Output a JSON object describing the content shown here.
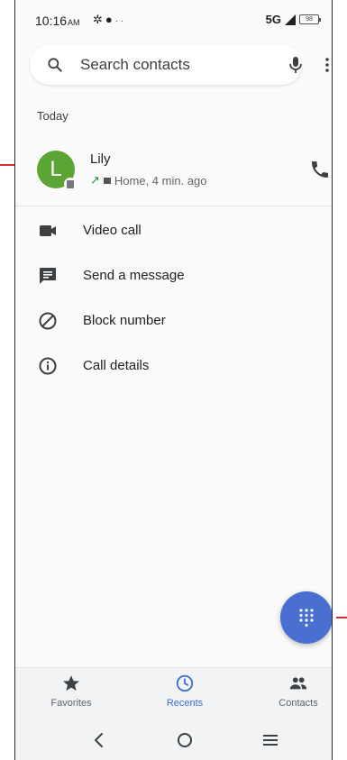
{
  "status_bar": {
    "time": "10:16",
    "ampm": "AM",
    "network": "5G",
    "battery": "98"
  },
  "search": {
    "placeholder": "Search contacts"
  },
  "recents": {
    "section_header": "Today",
    "entries": [
      {
        "name": "Lily",
        "avatar_letter": "L",
        "avatar_color": "#5ba534",
        "call_detail": "Home, 4 min. ago",
        "call_direction": "outgoing"
      }
    ]
  },
  "actions": [
    {
      "label": "Video call",
      "icon": "video-camera-icon"
    },
    {
      "label": "Send a message",
      "icon": "message-icon"
    },
    {
      "label": "Block number",
      "icon": "block-icon"
    },
    {
      "label": "Call details",
      "icon": "info-icon"
    }
  ],
  "bottom_nav": {
    "items": [
      {
        "label": "Favorites",
        "icon": "star-icon",
        "active": false
      },
      {
        "label": "Recents",
        "icon": "clock-icon",
        "active": true
      },
      {
        "label": "Contacts",
        "icon": "people-icon",
        "active": false
      }
    ]
  },
  "colors": {
    "accent": "#3f6bd4",
    "fab": "#4a6fd1",
    "avatar": "#5ba534",
    "callout": "#d32f2f"
  }
}
